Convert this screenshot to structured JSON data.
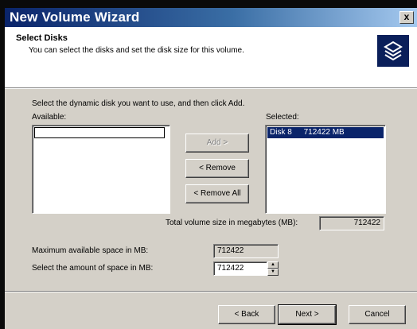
{
  "window": {
    "title": "New Volume Wizard",
    "close_glyph": "x"
  },
  "header": {
    "title": "Select Disks",
    "subtitle": "You can select the disks and set the disk size for this volume.",
    "icon": "disk-stack-icon"
  },
  "body": {
    "instruction": "Select the dynamic disk you want to use, and then click Add.",
    "available_label": "Available:",
    "selected_label": "Selected:",
    "available_items": [
      ""
    ],
    "selected_items": [
      {
        "disk": "Disk 8",
        "size": "712422 MB"
      }
    ],
    "add_label": "Add >",
    "remove_label": "< Remove",
    "remove_all_label": "< Remove All",
    "total_label": "Total volume size in megabytes (MB):",
    "total_value": "712422",
    "max_label": "Maximum available space in MB:",
    "max_value": "712422",
    "amount_label": "Select the amount of space in MB:",
    "amount_value": "712422"
  },
  "footer": {
    "back_label": "< Back",
    "next_label": "Next >",
    "cancel_label": "Cancel"
  },
  "colors": {
    "title_gradient_start": "#0a246a",
    "selection": "#0a246a",
    "dialog_face": "#d4d0c8"
  }
}
